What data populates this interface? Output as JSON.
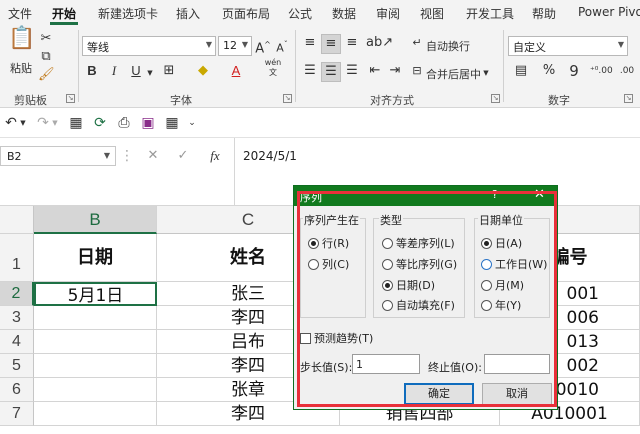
{
  "tabs": [
    "文件",
    "开始",
    "新建选项卡",
    "插入",
    "页面布局",
    "公式",
    "数据",
    "审阅",
    "视图",
    "开发工具",
    "帮助",
    "Power Pivot"
  ],
  "ribbon": {
    "clipboard": {
      "paste": "粘贴",
      "label": "剪贴板"
    },
    "font": {
      "name": "等线",
      "size": "12",
      "grow": "A^",
      "shrink": "Aˇ",
      "bold": "B",
      "italic": "I",
      "underline": "U",
      "phonetic": "wén",
      "label": "字体"
    },
    "alignment": {
      "wrap": "自动换行",
      "merge": "合并后居中",
      "label": "对齐方式"
    },
    "number": {
      "format": "自定义",
      "label": "数字"
    }
  },
  "formula_bar": {
    "name_box": "B2",
    "fx": "fx",
    "content": "2024/5/1"
  },
  "grid": {
    "columns": [
      "B",
      "C"
    ],
    "rows": [
      "1",
      "2",
      "3",
      "4",
      "5",
      "6",
      "7"
    ],
    "col_b": [
      "日期",
      "5月1日",
      "",
      "",
      "",
      "",
      ""
    ],
    "col_c": [
      "姓名",
      "张三",
      "李四",
      "吕布",
      "李四",
      "张章",
      "李四"
    ],
    "col_d_visible": [
      "",
      "",
      "",
      "",
      "",
      "",
      "销售四部"
    ],
    "col_e_visible": [
      "编号",
      "001",
      "006",
      "013",
      "002",
      "0010",
      "A010001"
    ]
  },
  "dialog": {
    "title": "序列",
    "help": "?",
    "close": "✕",
    "series_in": {
      "legend": "序列产生在",
      "options": [
        "行(R)",
        "列(C)"
      ],
      "selected": 0
    },
    "type": {
      "legend": "类型",
      "options": [
        "等差序列(L)",
        "等比序列(G)",
        "日期(D)",
        "自动填充(F)"
      ],
      "selected": 2
    },
    "date_unit": {
      "legend": "日期单位",
      "options": [
        "日(A)",
        "工作日(W)",
        "月(M)",
        "年(Y)"
      ],
      "selected": 0
    },
    "trend": "预测趋势(T)",
    "step_label": "步长值(S):",
    "step_value": "1",
    "stop_label": "终止值(O):",
    "stop_value": "",
    "ok": "确定",
    "cancel": "取消"
  }
}
